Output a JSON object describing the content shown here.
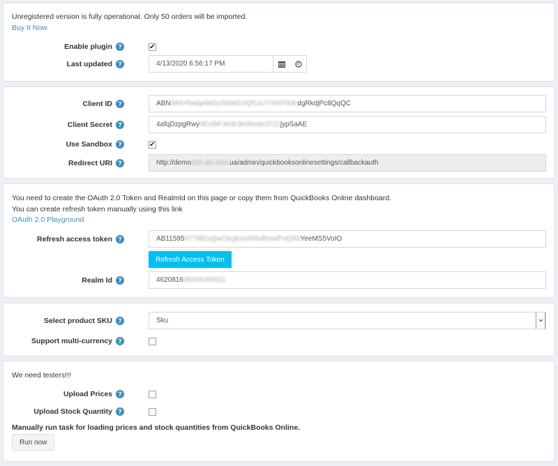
{
  "license_panel": {
    "notice": "Unregistered version is fully operational. Only 50 orders will be imported.",
    "buy_link": "Buy It Now",
    "enable_plugin": {
      "label": "Enable plugin",
      "checked": true
    },
    "last_updated": {
      "label": "Last updated",
      "value": "4/13/2020 6:56:17 PM"
    }
  },
  "credentials_panel": {
    "client_id": {
      "label": "Client ID",
      "value_visible_start": "ABN",
      "value_blurred": "Wt4Yfwdg4W0ySt0MZcIQf1sUYWXF93c",
      "value_visible_end": "dgRkdjPc8QqQC"
    },
    "client_secret": {
      "label": "Client Secret",
      "value_visible_start": "4afqDzpgRwy",
      "value_blurred": "9Eu5tF3K8r3k00xwb1F22",
      "value_visible_end": "jypSaAE"
    },
    "use_sandbox": {
      "label": "Use Sandbox",
      "checked": true
    },
    "redirect_uri": {
      "label": "Redirect URI",
      "value_visible_start": "http://demo",
      "value_blurred": "420.am.test",
      "value_visible_end": ".ua/admin/quickbooksonlinesettings/callbackauth"
    }
  },
  "oauth_panel": {
    "line1": "You need to create the OAuth 2.0 Token and RealmId on this page or copy them from QuickBooks Online dashboard.",
    "line2": "You can create refresh token manually using this link",
    "playground_link": "OAuth 2.0 Playground",
    "refresh_token": {
      "label": "Refresh access token",
      "value_visible_start": "AB11595",
      "value_blurred": "07788Oy[jwCjeglcns0WvBmwPxlQ89",
      "value_visible_end": "YeeMS5VoIO"
    },
    "refresh_button": "Refresh Access Token",
    "realm_id": {
      "label": "Realm Id",
      "value_visible_start": "4620816",
      "value_blurred": "35004200521",
      "value_visible_end": ""
    }
  },
  "product_panel": {
    "sku": {
      "label": "Select product SKU",
      "selected": "Sku"
    },
    "multi_currency": {
      "label": "Support multi-currency",
      "checked": false
    }
  },
  "testers_panel": {
    "notice": "We need testers!!!",
    "upload_prices": {
      "label": "Upload Prices",
      "checked": false
    },
    "upload_stock": {
      "label": "Upload Stock Quantity",
      "checked": false
    },
    "manual_note": "Manually run task for loading prices and stock quantities from QuickBooks Online.",
    "run_button": "Run now"
  },
  "icons": {
    "help": "?",
    "check": "✔",
    "calendar": "calendar-icon",
    "clock": "clock-icon",
    "chevron": "chevron-down-icon"
  }
}
